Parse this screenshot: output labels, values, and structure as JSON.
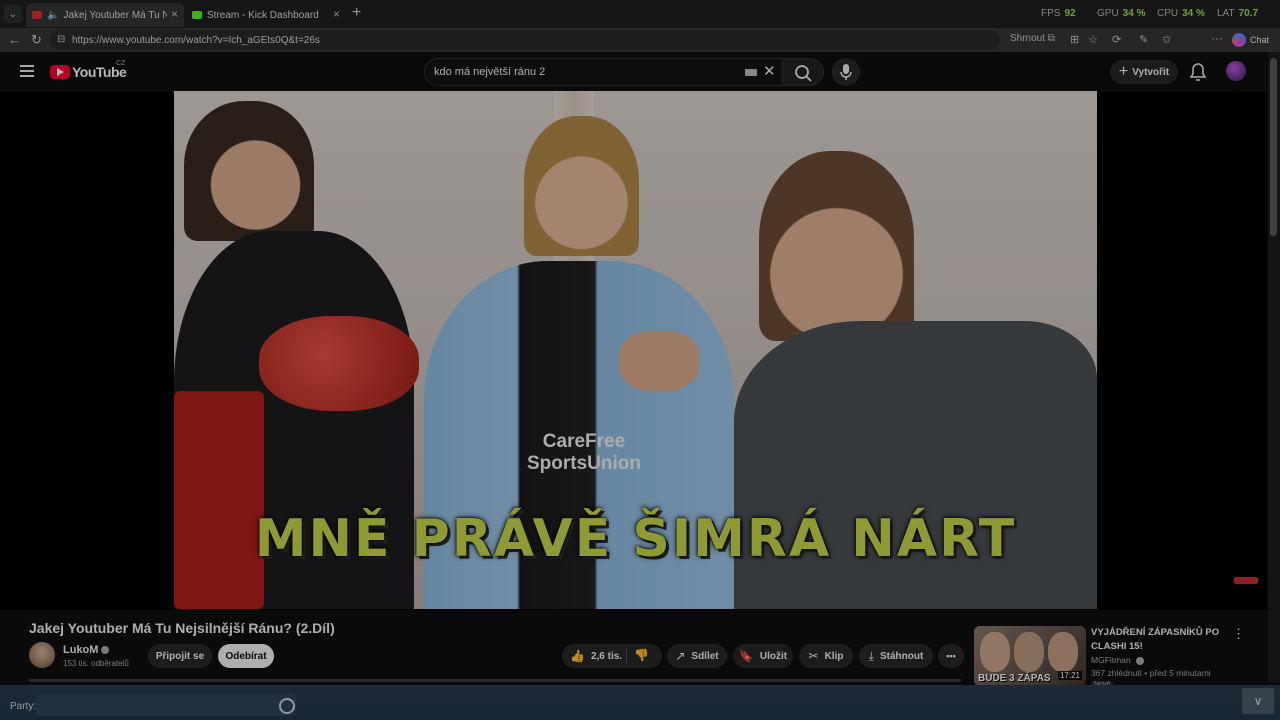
{
  "browser": {
    "tabs": [
      {
        "title": "Jakej Youtuber Má Tu Nejsilnější",
        "active": true,
        "favicon_color": "#e03030",
        "audio": true
      },
      {
        "title": "Stream - Kick Dashboard",
        "active": false,
        "favicon_color": "#53fc18"
      }
    ],
    "perf": {
      "fps_label": "FPS",
      "fps": "92",
      "gpu_label": "GPU",
      "gpu": "34 %",
      "cpu_label": "CPU",
      "cpu": "34 %",
      "lat_label": "LAT",
      "lat": "70.7"
    },
    "url": "https://www.youtube.com/watch?v=Ich_aGEts0Q&t=26s",
    "toolbar": {
      "summary_label": "Shrnout",
      "chat_label": "Chat"
    }
  },
  "youtube": {
    "logo_text": "YouTube",
    "region": "CZ",
    "search_value": "kdo má největší ránu 2",
    "create_label": "Vytvořit"
  },
  "video": {
    "caption": "MNĚ PRÁVĚ ŠIMRÁ NÁRT",
    "shirt_text": "CareFree SportsUnion",
    "title": "Jakej Youtuber Má Tu Nejsilnější Ránu? (2.Díl)",
    "channel": "LukoM",
    "subscribers": "153 tis. odběratelů",
    "join_label": "Připojit se",
    "subscribe_label": "Odebírat",
    "likes": "2,6 tis.",
    "share_label": "Sdílet",
    "save_label": "Uložit",
    "clip_label": "Klip",
    "download_label": "Stáhnout",
    "more_label": "•••"
  },
  "recommended": {
    "title": "VYJÁDŘENÍ ZÁPASNÍKŮ PO CLASHI 15!",
    "channel": "MGFitman",
    "views": "367 zhlédnutí",
    "age": "před 5 minutami",
    "badge": "Nové",
    "thumb_caption": "BUDE 3 ZÁPAS",
    "duration": "17:21"
  },
  "overlay": {
    "party_label": "Party:"
  }
}
